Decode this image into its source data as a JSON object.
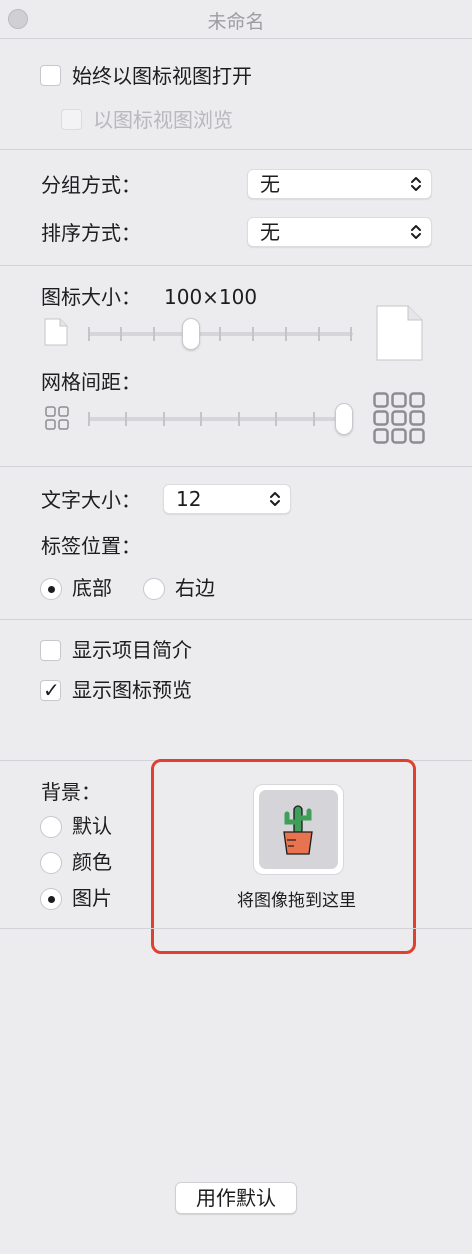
{
  "window": {
    "title": "未命名"
  },
  "options": {
    "always_open_icon_view": {
      "label": "始终以图标视图打开",
      "checked": false
    },
    "browse_icon_view": {
      "label": "以图标视图浏览",
      "checked": false,
      "disabled": true
    }
  },
  "grouping": {
    "group_by": {
      "label": "分组方式：",
      "value": "无"
    },
    "sort_by": {
      "label": "排序方式：",
      "value": "无"
    }
  },
  "icon_size": {
    "label": "图标大小：",
    "value": "100×100",
    "slider_fraction": 0.38
  },
  "grid_spacing": {
    "label": "网格间距：",
    "slider_fraction": 1.0
  },
  "text_size": {
    "label": "文字大小：",
    "value": "12"
  },
  "label_position": {
    "label": "标签位置：",
    "options": [
      {
        "label": "底部",
        "selected": true
      },
      {
        "label": "右边",
        "selected": false
      }
    ]
  },
  "display": {
    "show_item_info": {
      "label": "显示项目简介",
      "checked": false
    },
    "show_icon_preview": {
      "label": "显示图标预览",
      "checked": true
    }
  },
  "background": {
    "label": "背景：",
    "options": [
      {
        "label": "默认",
        "selected": false
      },
      {
        "label": "颜色",
        "selected": false
      },
      {
        "label": "图片",
        "selected": true
      }
    ],
    "drop_hint": "将图像拖到这里"
  },
  "use_as_defaults": {
    "label": "用作默认"
  },
  "colors": {
    "highlight": "#e0402e",
    "cactus": "#3f9e57",
    "pot": "#e8734f"
  }
}
